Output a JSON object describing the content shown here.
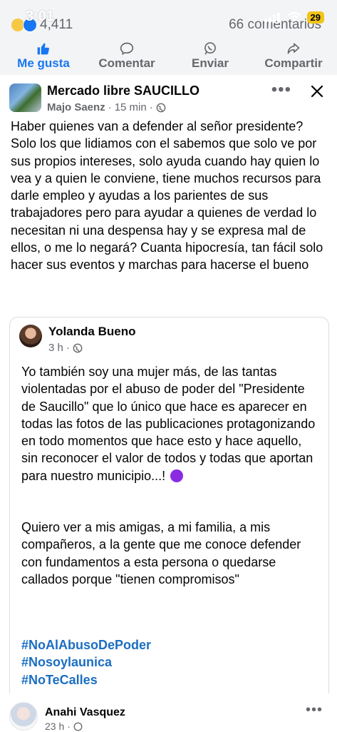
{
  "status": {
    "time": "3:01",
    "battery": "29"
  },
  "reactions": {
    "count": "4,411",
    "comments": "66 comentarios"
  },
  "actions": [
    {
      "label": "Me gusta",
      "icon": "thumbs-up-icon"
    },
    {
      "label": "Comentar",
      "icon": "comment-icon"
    },
    {
      "label": "Enviar",
      "icon": "whatsapp-icon"
    },
    {
      "label": "Compartir",
      "icon": "share-icon"
    }
  ],
  "post": {
    "group_name": "Mercado libre SAUCILLO",
    "author": "Majo Saenz",
    "time": "15 min",
    "text": "Haber quienes van a defender al señor presidente? Solo los que lidiamos con el sabemos que solo ve por sus propios intereses, solo ayuda cuando hay quien lo vea y a quien le conviene, tiene muchos recursos para darle empleo y ayudas a los parientes de sus trabajadores pero para ayudar a quienes de verdad lo necesitan ni una despensa hay y se expresa mal de ellos, o me lo negará? Cuanta hipocresía, tan fácil solo hacer sus eventos y marchas para hacerse el bueno"
  },
  "shared": {
    "name": "Yolanda Bueno",
    "time": "3 h",
    "paragraph1": "Yo también soy una mujer más, de las tantas violentadas por el abuso de poder del \"Presidente de Saucillo\"  que lo único que hace es aparecer en todas las fotos de las publicaciones protagonizando en todo momentos que hace esto y hace aquello, sin reconocer el valor de todos y todas que aportan para nuestro municipio...!",
    "paragraph2": "Quiero ver a mis amigas, a mi familia, a mis compañeros, a la gente que me conoce defender con fundamentos a esta persona o quedarse callados porque \"tienen compromisos\"",
    "hashtags": [
      "#NoAlAbusoDePoder",
      "#Nosoylaunica",
      "#NoTeCalles"
    ]
  },
  "comment": {
    "name": "Anahi Vasquez",
    "time": "23 h"
  },
  "colors": {
    "accent": "#1877f2",
    "hashtag": "#1b6ec2",
    "muted": "#65676b"
  }
}
